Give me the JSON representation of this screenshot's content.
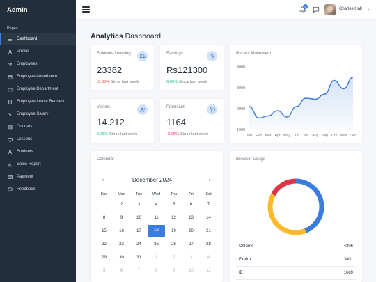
{
  "brand": "Admin",
  "sidebar": {
    "section": "Pages",
    "items": [
      {
        "label": "Dashboard"
      },
      {
        "label": "Profile"
      },
      {
        "label": "Employees"
      },
      {
        "label": "Employee Attendance"
      },
      {
        "label": "Employee Department"
      },
      {
        "label": "Employee Leave Request"
      },
      {
        "label": "Employee Salary"
      },
      {
        "label": "Courses"
      },
      {
        "label": "Lessons"
      },
      {
        "label": "Students"
      },
      {
        "label": "Sales Report"
      },
      {
        "label": "Payment"
      },
      {
        "label": "Feedback"
      }
    ]
  },
  "topbar": {
    "notification_count": "4",
    "user_name": "Charles Hall",
    "caret": "⌄"
  },
  "page": {
    "title_bold": "Analytics",
    "title_rest": " Dashboard"
  },
  "stats": [
    {
      "title": "Students Learning",
      "value": "23382",
      "delta": "-3.65%",
      "delta_type": "neg",
      "caption": " Since last week",
      "icon": "truck-icon"
    },
    {
      "title": "Earnings",
      "value": "Rs121300",
      "delta": "6.65%",
      "delta_type": "pos",
      "caption": " Since last week",
      "icon": "dollar-icon"
    },
    {
      "title": "Visitors",
      "value": "14.212",
      "delta": "5.25%",
      "delta_type": "pos",
      "caption": " Since last week",
      "icon": "users-icon"
    },
    {
      "title": "Premeium",
      "value": "1164",
      "delta": "-2.25%",
      "delta_type": "neg",
      "caption": " Since last week",
      "icon": "shopping-cart-icon"
    }
  ],
  "movement": {
    "title": "Recent Movement"
  },
  "chart_data": {
    "type": "area",
    "title": "Recent Movement",
    "x": [
      "Jan",
      "Feb",
      "Mar",
      "Apr",
      "May",
      "Jun",
      "Jul",
      "Aug",
      "Sep",
      "Oct",
      "Nov",
      "Dec"
    ],
    "series": [
      {
        "values": [
          2100,
          1550,
          1650,
          1900,
          1600,
          2100,
          2500,
          2450,
          2700,
          3350,
          2950,
          3500
        ]
      }
    ],
    "ylim": [
      1000,
      4000
    ],
    "yticks": [
      "1000",
      "2000",
      "3000",
      "4000"
    ],
    "grid": false,
    "color": "#3b7ddd"
  },
  "calendar": {
    "title": "Calendar",
    "month": "December  2024",
    "prev": "‹",
    "next": "›",
    "weekdays": [
      "Sun",
      "Mon",
      "Tue",
      "Wed",
      "Thu",
      "Fri",
      "Sat"
    ],
    "weeks": [
      [
        "1",
        "2",
        "3",
        "4",
        "5",
        "6",
        "7"
      ],
      [
        "8",
        "9",
        "10",
        "11",
        "12",
        "13",
        "14"
      ],
      [
        "15",
        "16",
        "17",
        "18",
        "19",
        "20",
        "21"
      ],
      [
        "22",
        "23",
        "24",
        "25",
        "26",
        "27",
        "28"
      ],
      [
        "29",
        "30",
        "31",
        "1",
        "2",
        "3",
        "4"
      ],
      [
        "5",
        "6",
        "7",
        "8",
        "9",
        "10",
        "11"
      ]
    ],
    "selected": "18"
  },
  "browser": {
    "title": "Browser Usage",
    "donut": [
      {
        "name": "Chrome",
        "value": 4306,
        "color": "#3b7ddd"
      },
      {
        "name": "Firefox",
        "value": 3801,
        "color": "#fcb92c"
      },
      {
        "name": "IE",
        "value": 1689,
        "color": "#dc3545"
      }
    ],
    "rows": [
      {
        "name": "Chrome",
        "value": "4306"
      },
      {
        "name": "Firefox",
        "value": "3801"
      },
      {
        "name": "IE",
        "value": "1689"
      }
    ]
  }
}
